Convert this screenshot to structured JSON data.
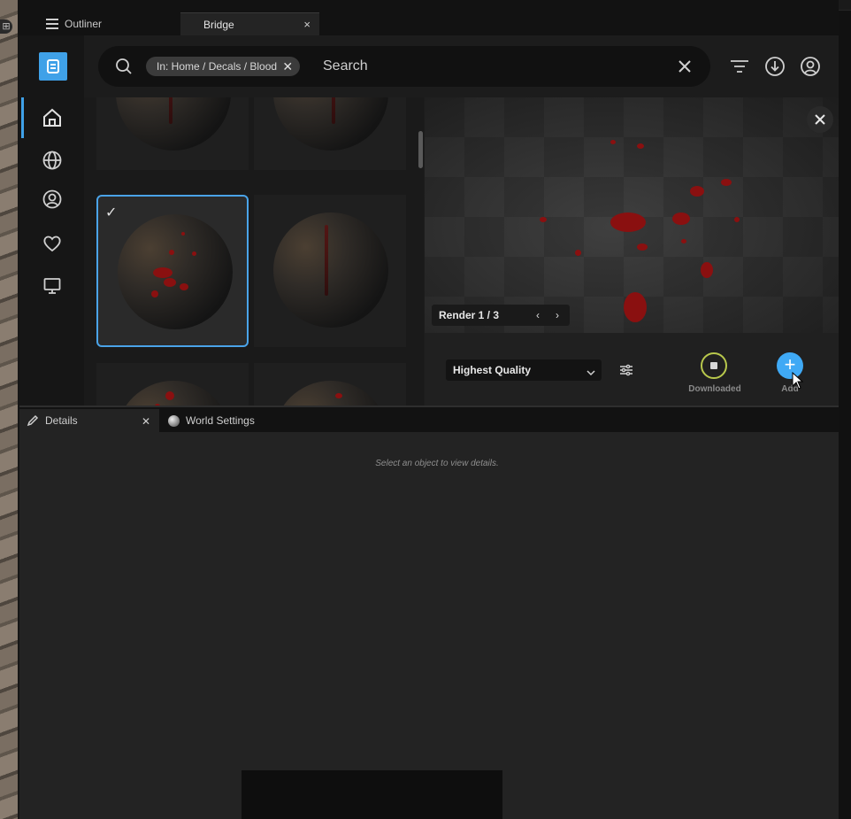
{
  "tabs": {
    "outliner": "Outliner",
    "bridge": "Bridge",
    "close_glyph": "×"
  },
  "search": {
    "chip": "In: Home / Decals / Blood",
    "placeholder": "Search"
  },
  "preview": {
    "render_label": "Render 1 / 3"
  },
  "actions": {
    "quality": "Highest Quality",
    "downloaded_label": "Downloaded",
    "add_label": "Add"
  },
  "details_panel": {
    "details_tab": "Details",
    "world_tab": "World Settings",
    "empty_message": "Select an object to view details."
  },
  "colors": {
    "accent": "#3fa9f5",
    "selection": "#4aa3e8",
    "downloaded_ring": "#b8c84c",
    "blood": "#8a1010"
  },
  "icons": [
    "grid-icon",
    "outliner-icon",
    "bridge-logo-icon",
    "home-icon",
    "globe-icon",
    "user-icon",
    "heart-icon",
    "monitor-icon",
    "search-icon",
    "close-icon",
    "filter-icon",
    "download-icon",
    "account-icon",
    "check-icon",
    "chevron-left-icon",
    "chevron-right-icon",
    "chevron-down-icon",
    "sliders-icon",
    "stop-icon",
    "plus-icon",
    "pencil-icon"
  ]
}
